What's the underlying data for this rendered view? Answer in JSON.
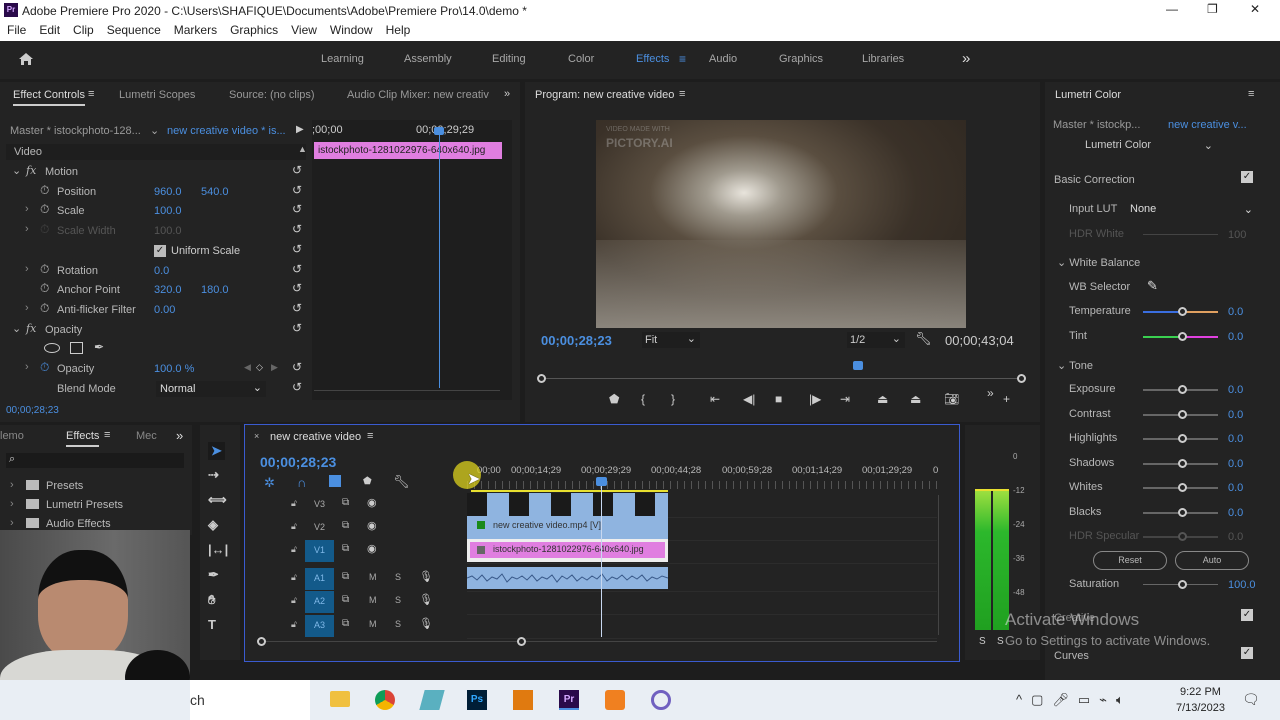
{
  "window": {
    "app_icon": "Pr",
    "title": "Adobe Premiere Pro 2020 - C:\\Users\\SHAFIQUE\\Documents\\Adobe\\Premiere Pro\\14.0\\demo *",
    "controls": [
      "—",
      "❐",
      "✕"
    ]
  },
  "menu": [
    "File",
    "Edit",
    "Clip",
    "Sequence",
    "Markers",
    "Graphics",
    "View",
    "Window",
    "Help"
  ],
  "workspaces": {
    "items": [
      "Learning",
      "Assembly",
      "Editing",
      "Color",
      "Effects",
      "Audio",
      "Graphics",
      "Libraries"
    ],
    "active": "Effects",
    "more": "»"
  },
  "effect_controls": {
    "tabs": [
      "Effect Controls",
      "Lumetri Scopes",
      "Source: (no clips)",
      "Audio Clip Mixer: new creativ"
    ],
    "master": "Master * istockphoto-128...",
    "sequence": "new creative video * is...",
    "ruler_start": ";00;00",
    "ruler_end": "00;00;29;29",
    "clip": "istockphoto-1281022976-640x640.jpg",
    "section": "Video",
    "rows": [
      {
        "kind": "fx",
        "label": "Motion"
      },
      {
        "kind": "prop",
        "label": "Position",
        "v1": "960.0",
        "v2": "540.0"
      },
      {
        "kind": "prop",
        "label": "Scale",
        "v1": "100.0",
        "expand": true
      },
      {
        "kind": "disabled",
        "label": "Scale Width",
        "v1": "100.0",
        "expand": true
      },
      {
        "kind": "check",
        "label": "Uniform Scale",
        "checked": true
      },
      {
        "kind": "prop",
        "label": "Rotation",
        "v1": "0.0",
        "expand": true
      },
      {
        "kind": "prop",
        "label": "Anchor Point",
        "v1": "320.0",
        "v2": "180.0"
      },
      {
        "kind": "prop",
        "label": "Anti-flicker Filter",
        "v1": "0.00",
        "expand": true
      },
      {
        "kind": "fx",
        "label": "Opacity"
      },
      {
        "kind": "masks"
      },
      {
        "kind": "prop",
        "label": "Opacity",
        "v1": "100.0 %",
        "expand": true,
        "keyframe": true
      },
      {
        "kind": "select",
        "label": "Blend Mode",
        "v1": "Normal"
      }
    ],
    "timecode": "00;00;28;23"
  },
  "program": {
    "title": "Program: new creative video",
    "watermark_line1": "VIDEO MADE WITH",
    "watermark_line2": "PICTORY.AI",
    "timecode": "00;00;28;23",
    "fit": "Fit",
    "resolution": "1/2",
    "duration": "00;00;43;04",
    "playhead_fraction": 0.66
  },
  "lumetri": {
    "title": "Lumetri Color",
    "master": "Master * istockp...",
    "sequence": "new creative v...",
    "effect": "Lumetri Color",
    "basic_correction": "Basic Correction",
    "input_lut_label": "Input LUT",
    "input_lut_value": "None",
    "hdr_white_label": "HDR White",
    "hdr_white_value": "100",
    "white_balance": "White Balance",
    "wb_selector": "WB Selector",
    "wb_sliders": [
      {
        "label": "Temperature",
        "value": "0.0"
      },
      {
        "label": "Tint",
        "value": "0.0"
      }
    ],
    "tone": "Tone",
    "tone_sliders": [
      {
        "label": "Exposure",
        "value": "0.0"
      },
      {
        "label": "Contrast",
        "value": "0.0"
      },
      {
        "label": "Highlights",
        "value": "0.0"
      },
      {
        "label": "Shadows",
        "value": "0.0"
      },
      {
        "label": "Whites",
        "value": "0.0"
      },
      {
        "label": "Blacks",
        "value": "0.0"
      },
      {
        "label": "HDR Specular",
        "value": "0.0",
        "disabled": true
      }
    ],
    "reset": "Reset",
    "auto": "Auto",
    "saturation_label": "Saturation",
    "saturation_value": "100.0",
    "creative": "Creative",
    "curves": "Curves"
  },
  "activation": {
    "line1": "Activate Windows",
    "line2": "Go to Settings to activate Windows."
  },
  "effects_panel": {
    "tabs": [
      "lemo",
      "Effects",
      "Mec"
    ],
    "items": [
      "Presets",
      "Lumetri Presets",
      "Audio Effects"
    ]
  },
  "timeline": {
    "title": "new creative video",
    "timecode": "00;00;28;23",
    "ruler": [
      "00;00",
      "00;00;14;29",
      "00;00;29;29",
      "00;00;44;28",
      "00;00;59;28",
      "00;01;14;29",
      "00;01;29;29",
      "0"
    ],
    "video_tracks": [
      "V3",
      "V2",
      "V1"
    ],
    "audio_tracks": [
      "A1",
      "A2",
      "A3"
    ],
    "mute": "M",
    "solo": "S",
    "clip_v2": "new creative video.mp4 [V]",
    "clip_v1": "istockphoto-1281022976-640x640.jpg"
  },
  "audio_meter": {
    "labels": [
      "0",
      "-12",
      "-24",
      "-36",
      "-48"
    ],
    "solo": [
      "S",
      "S"
    ]
  },
  "taskbar": {
    "search": "ch",
    "time": "9:22 PM",
    "date": "7/13/2023"
  },
  "colors": {
    "accent": "#4b8fe0",
    "clip_pink": "#e07ee0",
    "clip_blue": "#8fb4e0",
    "active_border": "#3a5bd0"
  }
}
